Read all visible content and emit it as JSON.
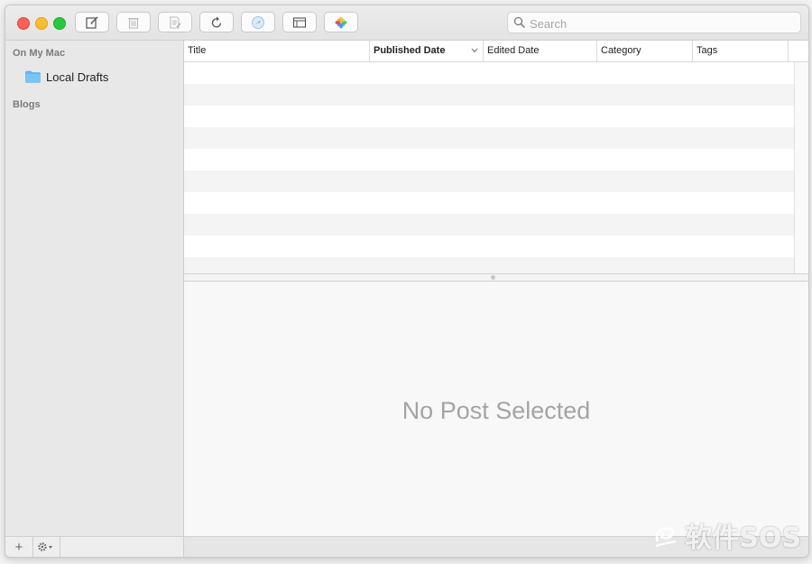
{
  "toolbar": {
    "buttons": [
      {
        "icon": "compose-icon"
      },
      {
        "icon": "trash-icon"
      },
      {
        "icon": "edit-document-icon"
      },
      {
        "icon": "refresh-icon"
      },
      {
        "icon": "preview-safari-icon"
      },
      {
        "icon": "toggle-sidebar-icon"
      },
      {
        "icon": "photos-icon"
      }
    ],
    "search": {
      "placeholder": "Search",
      "value": ""
    }
  },
  "sidebar": {
    "sections": [
      {
        "header": "On My Mac",
        "items": [
          {
            "label": "Local Drafts",
            "icon": "folder-icon"
          }
        ]
      },
      {
        "header": "Blogs",
        "items": []
      }
    ],
    "footer": {
      "add": "+",
      "gear_icon": "gear-icon"
    }
  },
  "table": {
    "columns": [
      "Title",
      "Published Date",
      "Edited Date",
      "Category",
      "Tags"
    ],
    "sorted_column": "Published Date",
    "rows": []
  },
  "detail": {
    "empty_message": "No Post Selected"
  },
  "watermark": {
    "text": "软件SOS"
  },
  "colors": {
    "close": "#fc5f57",
    "minimize": "#fdbc2e",
    "zoom": "#28c840",
    "folder": "#64b7ea"
  }
}
